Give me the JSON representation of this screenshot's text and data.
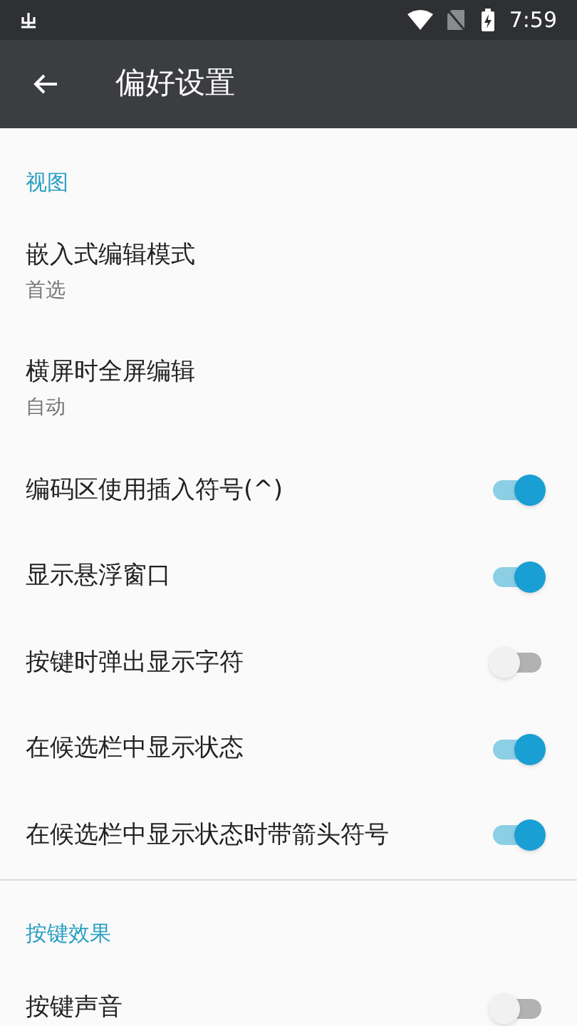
{
  "status_bar": {
    "time": "7:59"
  },
  "toolbar": {
    "title": "偏好设置"
  },
  "sections": [
    {
      "title": "视图",
      "items": [
        {
          "kind": "summary",
          "title": "嵌入式编辑模式",
          "summary": "首选"
        },
        {
          "kind": "summary",
          "title": "横屏时全屏编辑",
          "summary": "自动"
        },
        {
          "kind": "switch",
          "title": "编码区使用插入符号(^)",
          "on": true
        },
        {
          "kind": "switch",
          "title": "显示悬浮窗口",
          "on": true
        },
        {
          "kind": "switch",
          "title": "按键时弹出显示字符",
          "on": false
        },
        {
          "kind": "switch",
          "title": "在候选栏中显示状态",
          "on": true
        },
        {
          "kind": "switch",
          "title": "在候选栏中显示状态时带箭头符号",
          "on": true
        }
      ]
    },
    {
      "title": "按键效果",
      "items": [
        {
          "kind": "switch",
          "title": "按键声音",
          "on": false
        }
      ]
    }
  ]
}
